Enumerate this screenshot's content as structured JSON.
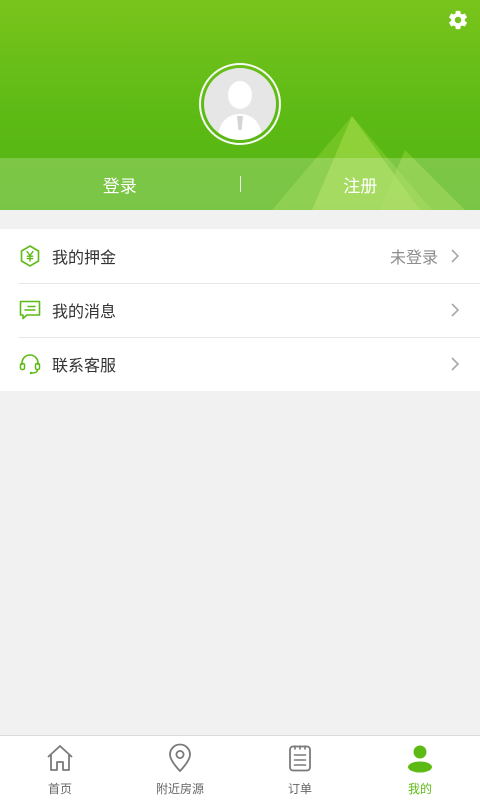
{
  "header": {
    "login_label": "登录",
    "register_label": "注册"
  },
  "menu": {
    "items": [
      {
        "label": "我的押金",
        "status": "未登录",
        "icon": "deposit-yen-icon"
      },
      {
        "label": "我的消息",
        "status": "",
        "icon": "message-icon"
      },
      {
        "label": "联系客服",
        "status": "",
        "icon": "headset-icon"
      }
    ]
  },
  "tabbar": {
    "items": [
      {
        "label": "首页",
        "icon": "home-icon",
        "active": false
      },
      {
        "label": "附近房源",
        "icon": "location-pin-icon",
        "active": false
      },
      {
        "label": "订单",
        "icon": "order-list-icon",
        "active": false
      },
      {
        "label": "我的",
        "icon": "user-icon",
        "active": true
      }
    ]
  },
  "colors": {
    "brand_green": "#5dba15",
    "header_top": "#79c41c",
    "text_primary": "#333333",
    "text_secondary": "#8c8c8c",
    "tab_inactive": "#666666",
    "page_bg": "#f1f1f1"
  }
}
